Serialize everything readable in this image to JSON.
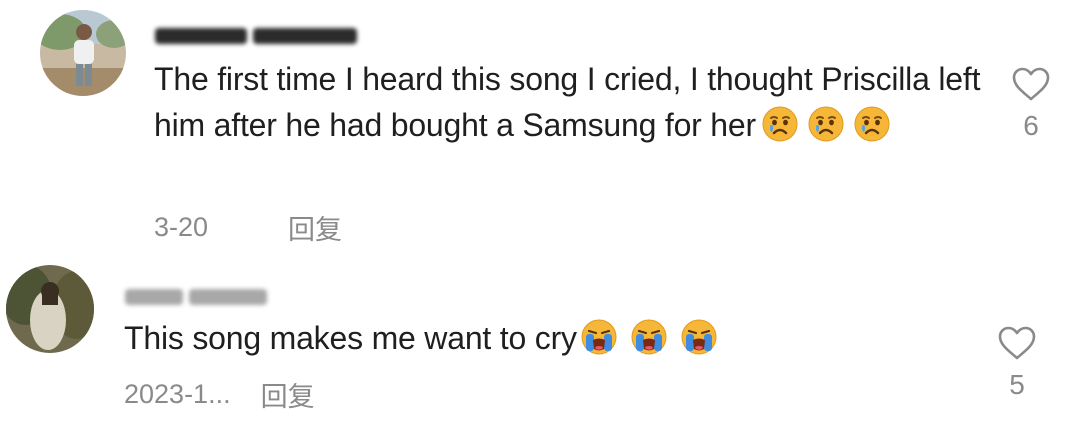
{
  "comments": [
    {
      "text": "The first time I heard this song I cried, I thought Priscilla left him after he had bought a Samsung for her",
      "emojis": [
        "sad-cry-emoji",
        "sad-cry-emoji",
        "sad-cry-emoji"
      ],
      "date": "3-20",
      "reply_label": "回复",
      "like_count": "6",
      "icon": "heart-outline-icon"
    },
    {
      "text": "This song makes me want to cry",
      "emojis": [
        "loudly-crying-emoji",
        "loudly-crying-emoji",
        "loudly-crying-emoji"
      ],
      "date": "2023-1...",
      "reply_label": "回复",
      "like_count": "5",
      "icon": "heart-outline-icon"
    }
  ],
  "colors": {
    "text": "#1f1f1f",
    "meta": "#8a8a8a",
    "emoji_face": "#f7b52c"
  }
}
